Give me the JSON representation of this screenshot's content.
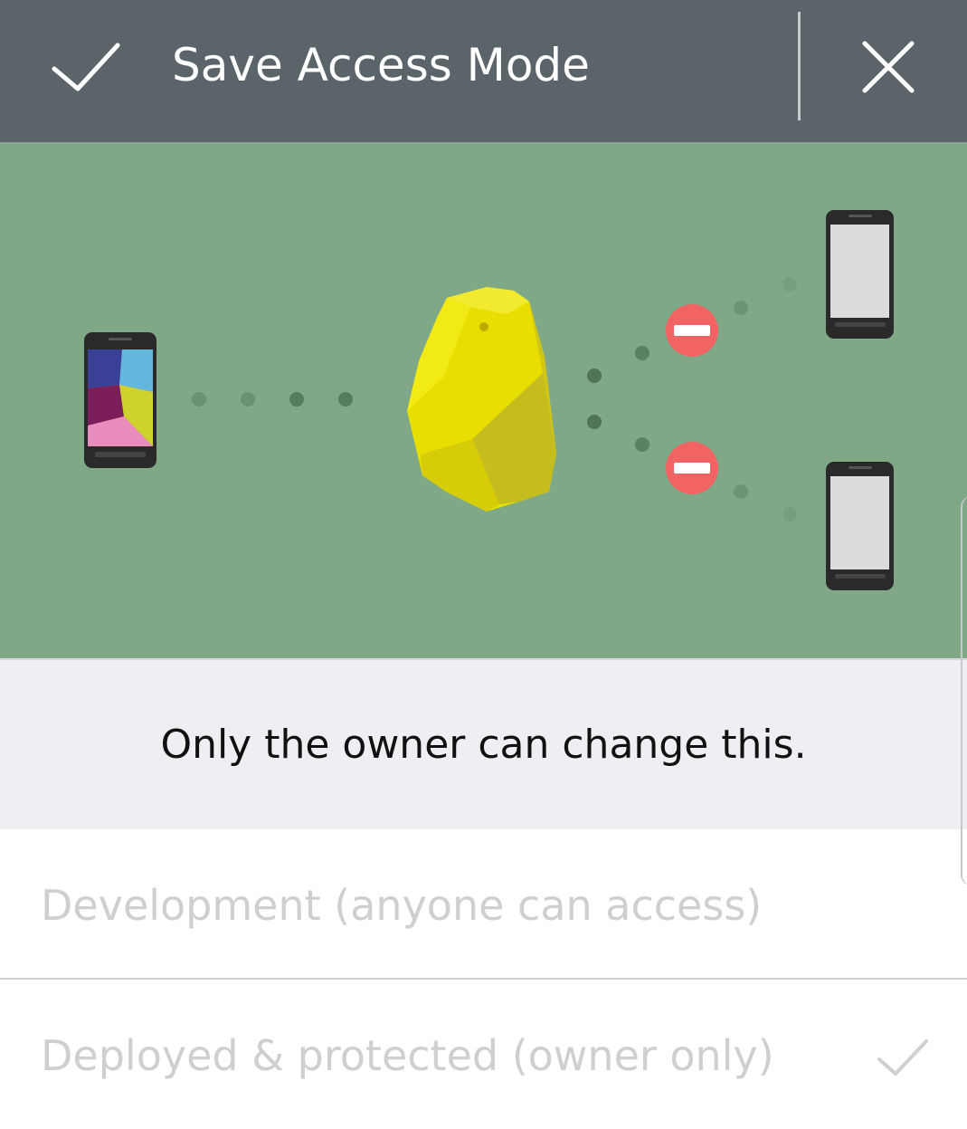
{
  "toolbar": {
    "title": "Save Access Mode",
    "confirm_icon": "check-icon",
    "close_icon": "close-icon",
    "background": "#5b6569"
  },
  "illustration": {
    "background": "#7fa887",
    "icons": [
      "owner-phone-icon",
      "beacon-icon",
      "blocked-phone-icon",
      "no-entry-icon"
    ]
  },
  "note": {
    "text": "Only the owner can change this."
  },
  "options": [
    {
      "label": "Development (anyone can access)",
      "selected": false
    },
    {
      "label": "Deployed & protected (owner only)",
      "selected": true
    }
  ],
  "colors": {
    "beacon": "#e8df00",
    "blocked_badge": "#f26363",
    "option_text": "#cfcfd1"
  }
}
